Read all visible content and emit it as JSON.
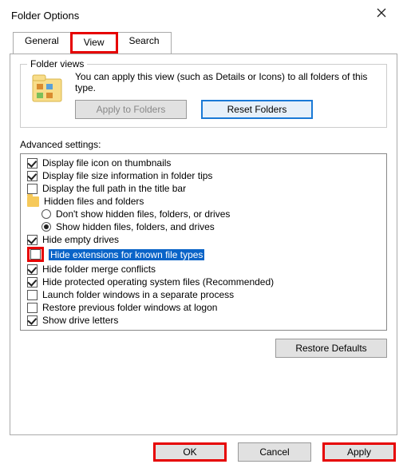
{
  "window": {
    "title": "Folder Options"
  },
  "tabs": {
    "general": "General",
    "view": "View",
    "search": "Search"
  },
  "folderViews": {
    "legend": "Folder views",
    "desc": "You can apply this view (such as Details or Icons) to all folders of this type.",
    "applyBtn": "Apply to Folders",
    "resetBtn": "Reset Folders"
  },
  "adv": {
    "label": "Advanced settings:",
    "items": {
      "i0": "Display file icon on thumbnails",
      "i1": "Display file size information in folder tips",
      "i2": "Display the full path in the title bar",
      "i3": "Hidden files and folders",
      "i4": "Don't show hidden files, folders, or drives",
      "i5": "Show hidden files, folders, and drives",
      "i6": "Hide empty drives",
      "i7": "Hide extensions for known file types",
      "i8": "Hide folder merge conflicts",
      "i9": "Hide protected operating system files (Recommended)",
      "i10": "Launch folder windows in a separate process",
      "i11": "Restore previous folder windows at logon",
      "i12": "Show drive letters"
    }
  },
  "restoreDefaults": "Restore Defaults",
  "footer": {
    "ok": "OK",
    "cancel": "Cancel",
    "apply": "Apply"
  }
}
